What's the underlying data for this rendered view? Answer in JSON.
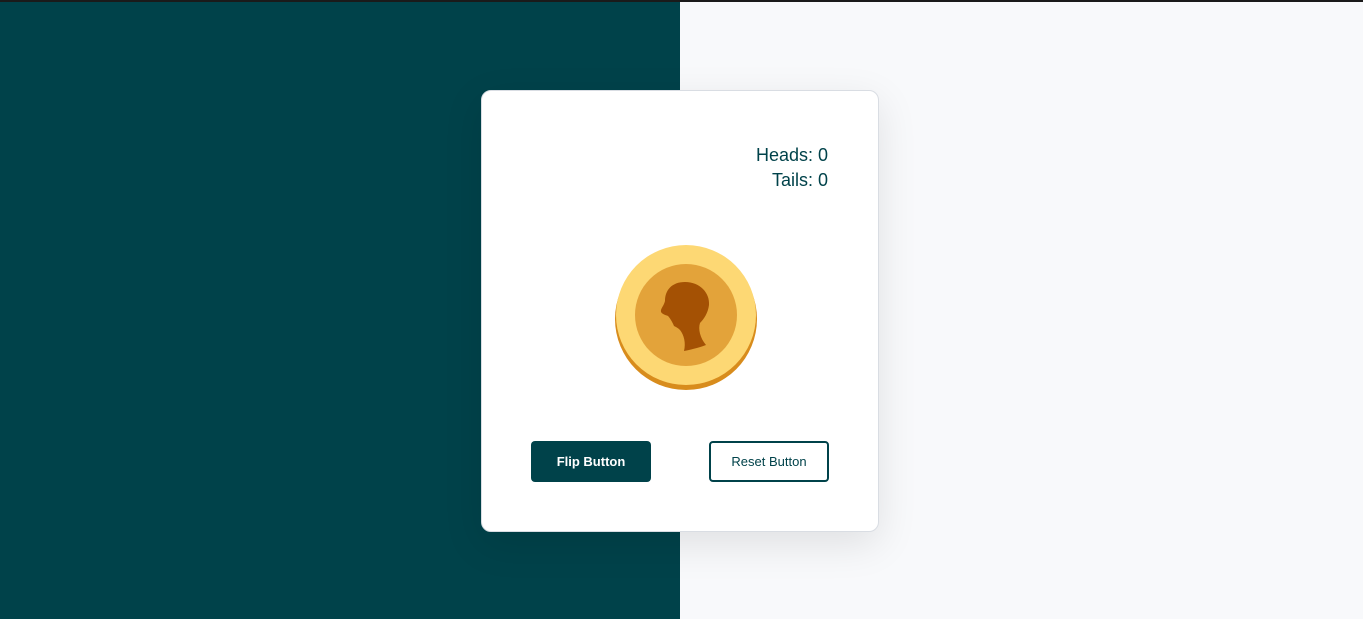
{
  "colors": {
    "left_panel": "#00424a",
    "right_panel": "#f8f9fb",
    "accent": "#00424a",
    "coin_rim": "#fdd874",
    "coin_edge": "#d88c1c",
    "coin_face": "#e3a33a",
    "silhouette": "#a45104"
  },
  "score": {
    "heads_label": "Heads: 0",
    "tails_label": "Tails: 0"
  },
  "coin": {
    "side": "heads",
    "icon": "coin-head-silhouette-icon"
  },
  "buttons": {
    "flip_label": "Flip Button",
    "reset_label": "Reset Button"
  }
}
